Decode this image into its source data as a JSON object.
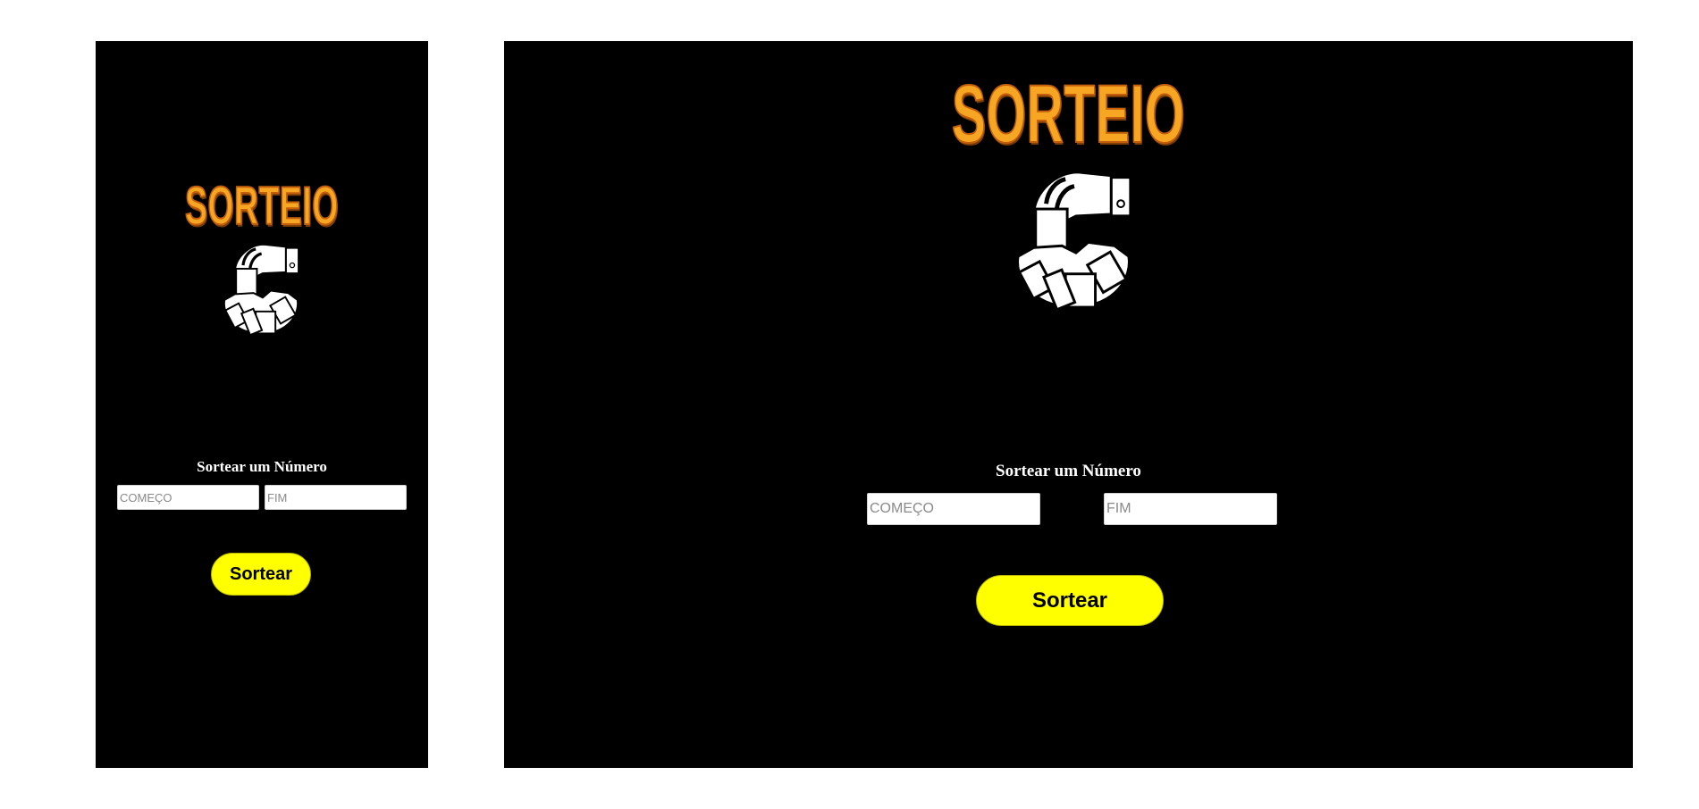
{
  "app": {
    "logo_text": "SORTEIO",
    "form_title": "Sortear um Número",
    "start_placeholder": "COMEÇO",
    "end_placeholder": "FIM",
    "draw_button": "Sortear",
    "illustration_icon": "hand-drawing-ticket-from-bowl-icon"
  },
  "colors": {
    "background": "#000000",
    "page": "#ffffff",
    "logo": "#f7a623",
    "button": "#ffff00",
    "text": "#ffffff"
  }
}
